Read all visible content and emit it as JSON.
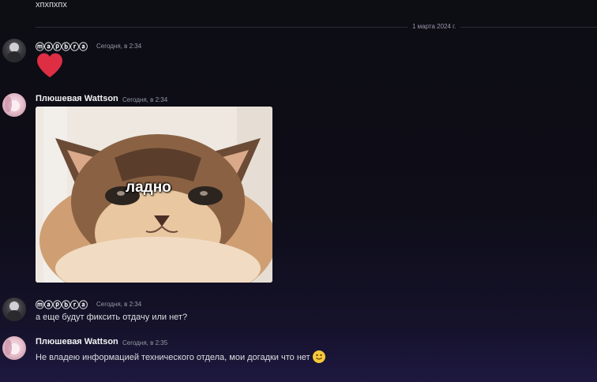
{
  "previous_message": {
    "text": "хпхпхпх"
  },
  "date_divider": {
    "label": "1 марта 2024 г."
  },
  "messages": [
    {
      "author": "ⓜⓐⓟⓑⓡⓐ",
      "timestamp": "Сегодня, в 2:34",
      "content_type": "heart-emoji"
    },
    {
      "author": "Плюшевая Wattson",
      "timestamp": "Сегодня, в 2:34",
      "content_type": "image",
      "image_caption": "ладно"
    },
    {
      "author": "ⓜⓐⓟⓑⓡⓐ",
      "timestamp": "Сегодня, в 2:34",
      "text": "а еще будут фиксить отдачу или нет?"
    },
    {
      "author": "Плюшевая Wattson",
      "timestamp": "Сегодня, в 2:35",
      "text": "Не владею информацией технического отдела, мои догадки что нет",
      "trailing_emoji": "slightly-smiling-face"
    }
  ],
  "colors": {
    "heart": "#dd2e44",
    "author": "#f2f3f5",
    "timestamp": "#949ba4",
    "text": "#dbdee1"
  }
}
